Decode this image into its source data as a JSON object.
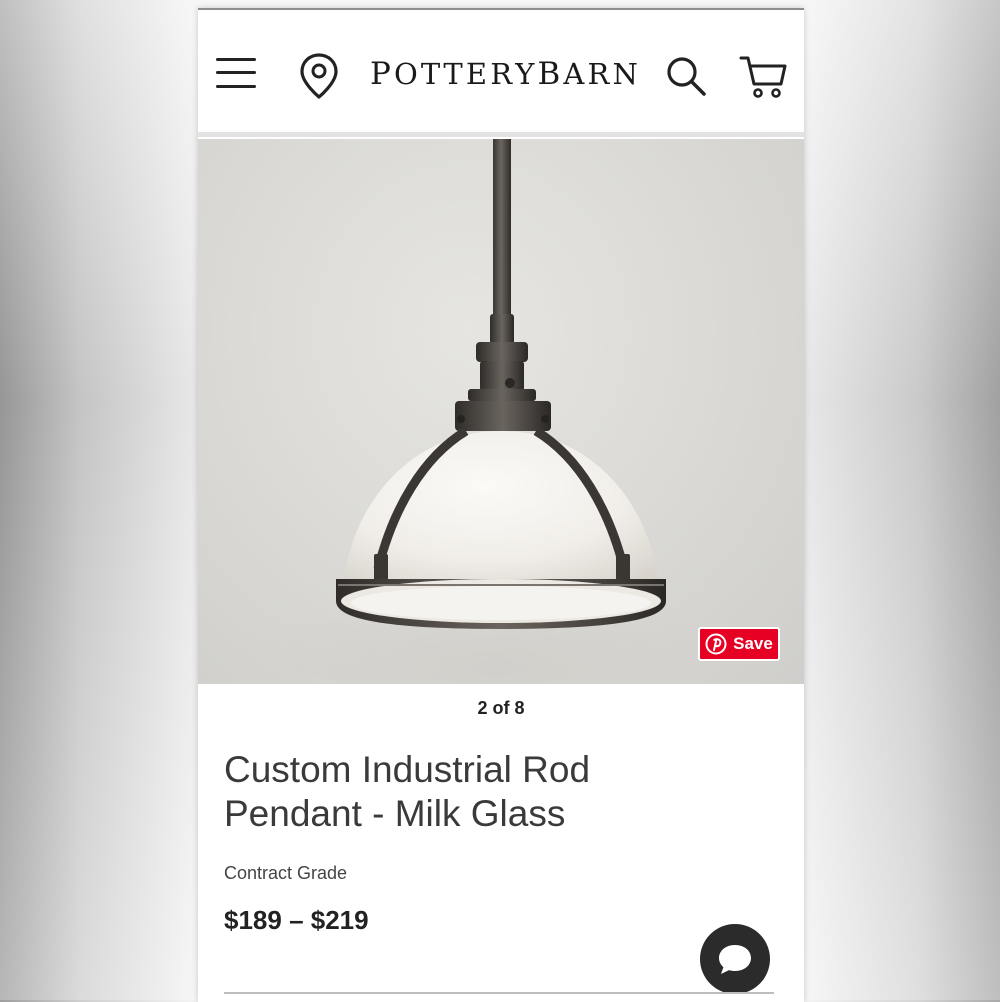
{
  "header": {
    "logo_letters": [
      "P",
      "O",
      "T",
      "T",
      "E",
      "R",
      "Y",
      "B",
      "A",
      "R",
      "N"
    ],
    "icons": [
      "menu-icon",
      "location-pin-icon",
      "search-icon",
      "cart-icon"
    ]
  },
  "gallery": {
    "counter": "2 of 8",
    "save_label": "Save",
    "save_color": "#e60023"
  },
  "product": {
    "title_line1": "Custom Industrial Rod",
    "title_line2": "Pendant - Milk Glass",
    "grade": "Contract Grade",
    "price": "$189 – $219"
  },
  "colors": {
    "header_bg": "#ffffff",
    "text_primary": "#222222",
    "chat_button": "#2b2b2b"
  }
}
